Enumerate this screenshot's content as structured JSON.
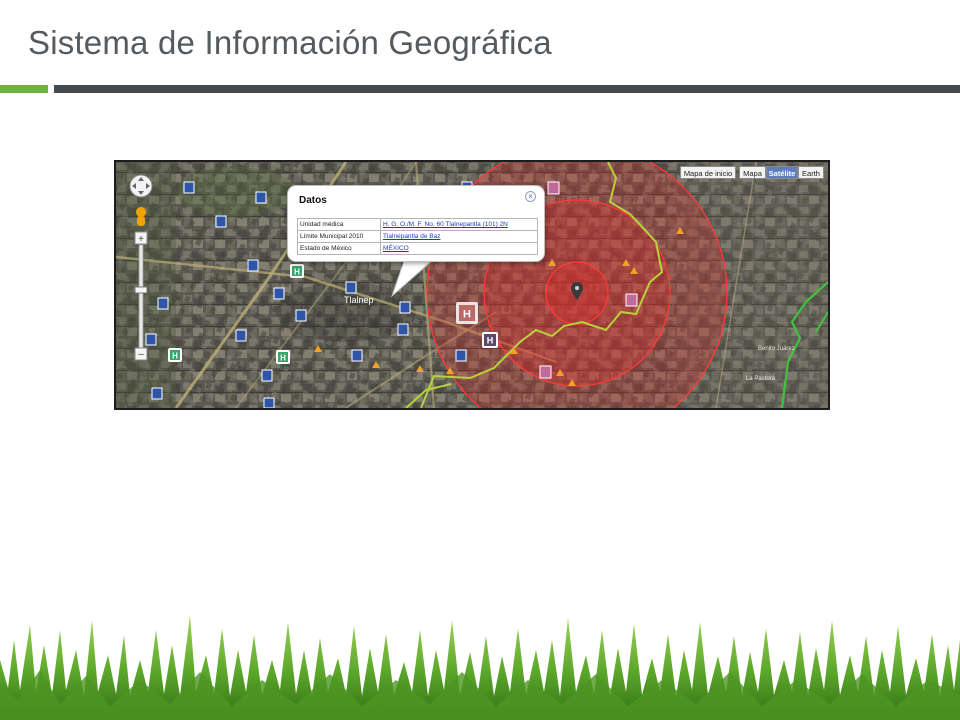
{
  "slide": {
    "title": "Sistema de Información Geográfica"
  },
  "map": {
    "map_types": {
      "home": "Mapa de inicio",
      "map": "Mapa",
      "satellite": "Satélite",
      "earth": "Earth"
    },
    "active_map_type": "Satélite",
    "place_label": "Tlalnep",
    "district_labels": [
      "Benito Juárez",
      "La Pastora"
    ],
    "icons": [
      "hospital-marker-icon",
      "clinic-marker-icon",
      "fire-marker-icon",
      "location-pin-icon",
      "zoom-slider",
      "pan-control-icon",
      "pegman-icon"
    ],
    "colors": {
      "buffer": "#e23030",
      "boundary": "#b6d33a",
      "boundary_alt": "#3fc43f",
      "active_button": "#5c7fb8"
    }
  },
  "popup": {
    "title": "Datos",
    "rows": [
      {
        "key": "Unidad médica",
        "value": "H. G. O./M. F. No. 60 Tlalnepantla (101) 2N"
      },
      {
        "key": "Límite Municipal 2010",
        "value": "Tlalnepantla de Baz"
      },
      {
        "key": "Estado de México",
        "value": "MÉXICO"
      }
    ]
  }
}
